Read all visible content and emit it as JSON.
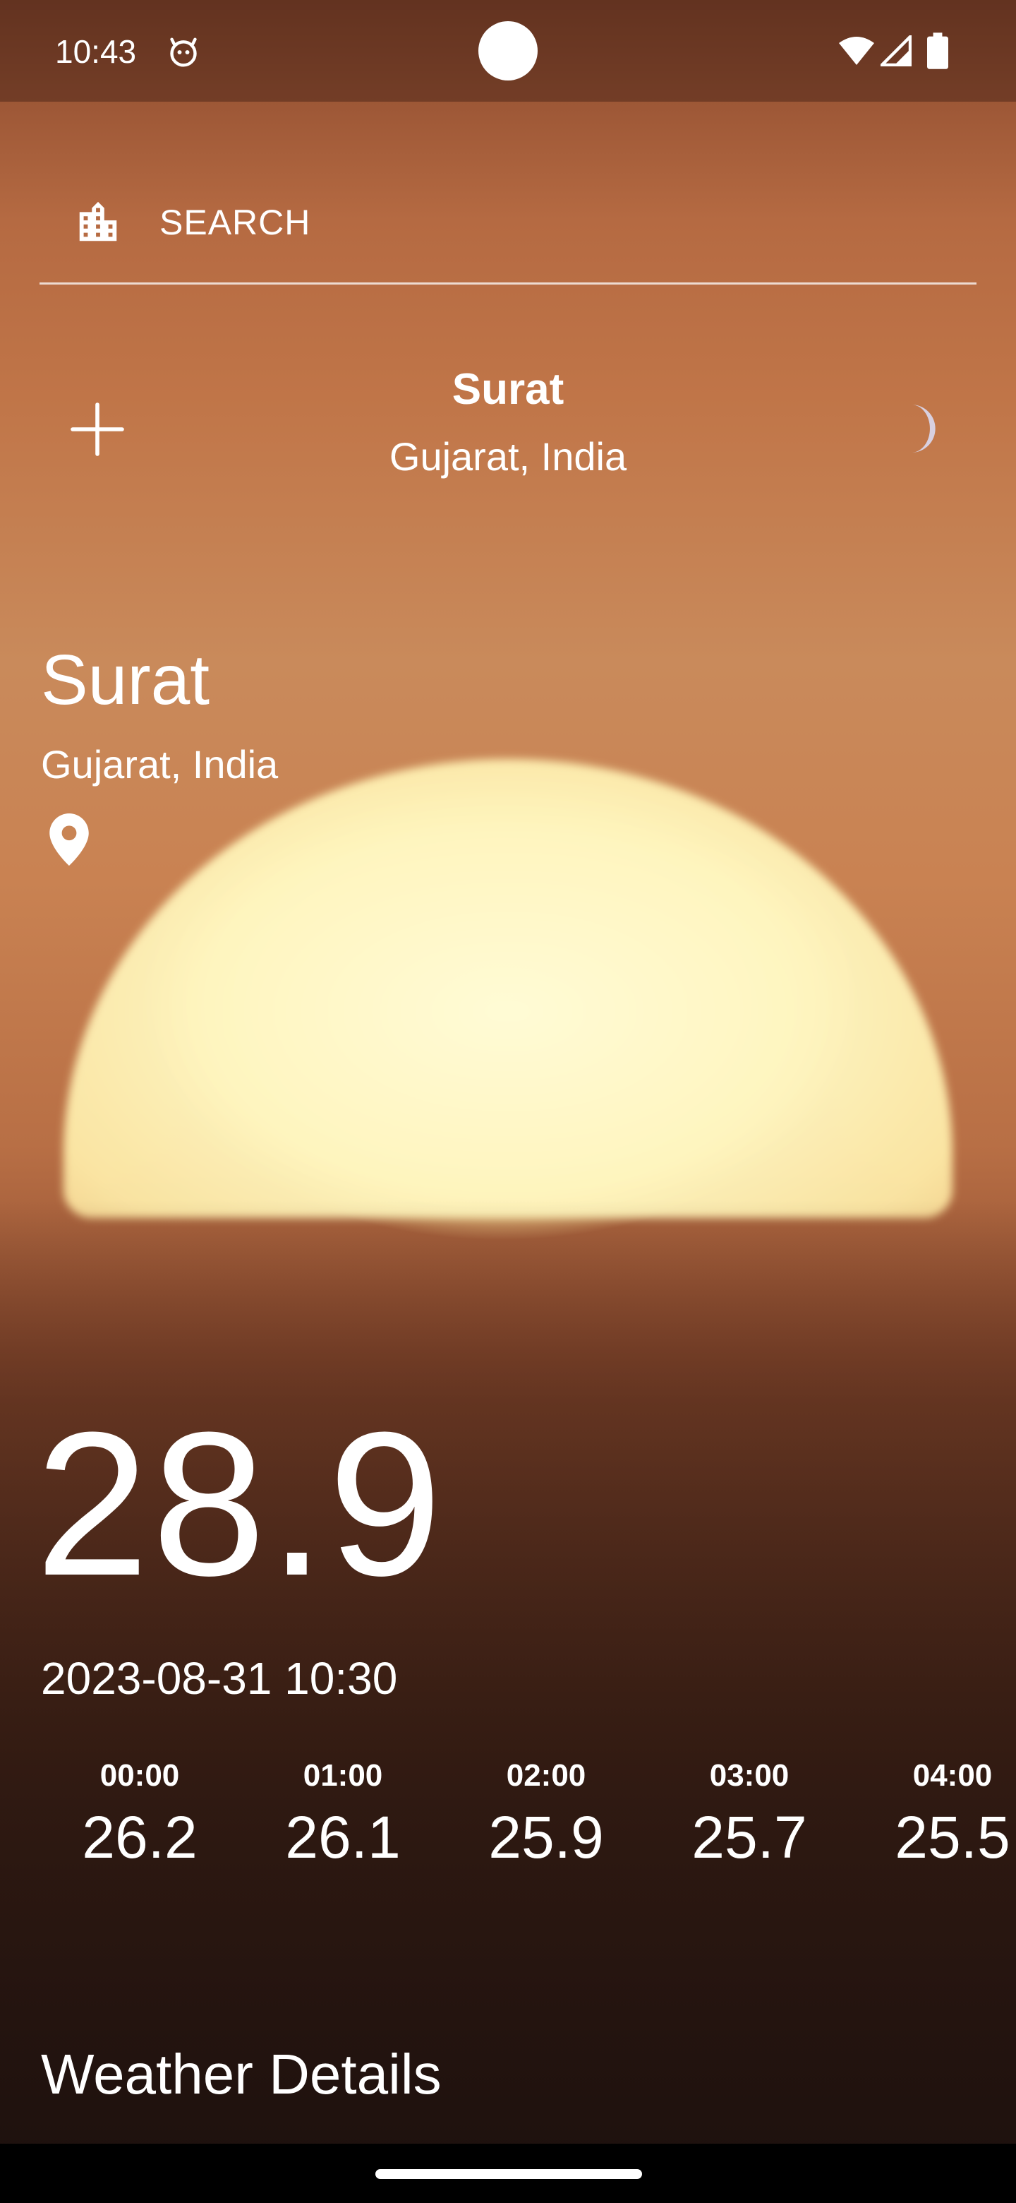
{
  "status_bar": {
    "time": "10:43",
    "icons": [
      "face-icon",
      "wifi-icon",
      "signal-icon",
      "battery-icon"
    ]
  },
  "search": {
    "label": "SEARCH",
    "icon": "city-icon"
  },
  "header": {
    "title": "Surat",
    "subtitle": "Gujarat, India",
    "add_icon": "plus-icon",
    "theme_icon": "moon-icon"
  },
  "location": {
    "city": "Surat",
    "region": "Gujarat, India",
    "icon": "pin-icon"
  },
  "current": {
    "temperature": "28.9",
    "datetime": "2023-08-31 10:30"
  },
  "hourly": [
    {
      "time": "00:00",
      "temp": "26.2"
    },
    {
      "time": "01:00",
      "temp": "26.1"
    },
    {
      "time": "02:00",
      "temp": "25.9"
    },
    {
      "time": "03:00",
      "temp": "25.7"
    },
    {
      "time": "04:00",
      "temp": "25.5"
    }
  ],
  "details": {
    "heading": "Weather Details"
  },
  "colors": {
    "text": "#ffffff",
    "moon": "#d8d0e0",
    "sun": "#fff4b8",
    "sky": "#c07548"
  }
}
